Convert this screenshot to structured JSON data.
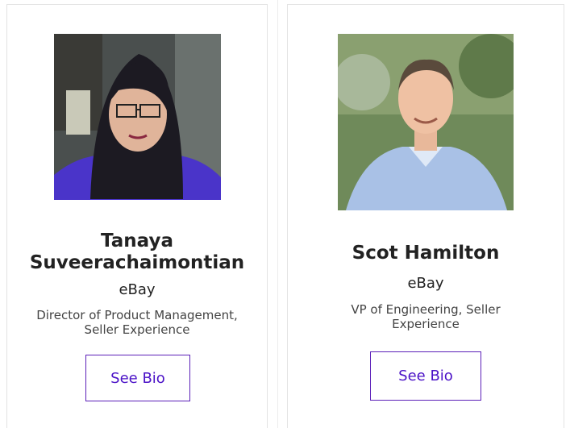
{
  "speakers": [
    {
      "name_line1": "Tanaya",
      "name_line2": "Suveerachaimontian",
      "company": "eBay",
      "title_line1": "Director of Product Management,",
      "title_line2": "Seller Experience",
      "button_label": "See Bio",
      "photo": "portrait-woman-glasses"
    },
    {
      "name_line1": "Scot Hamilton",
      "company": "eBay",
      "title_line1": "VP of Engineering, Seller",
      "title_line2": "Experience",
      "button_label": "See Bio",
      "photo": "portrait-man-blue-shirt"
    }
  ],
  "colors": {
    "button_text": "#4b12c7",
    "button_border": "#5b1fb8",
    "card_border": "#e3e3e3",
    "name_text": "#222222"
  }
}
